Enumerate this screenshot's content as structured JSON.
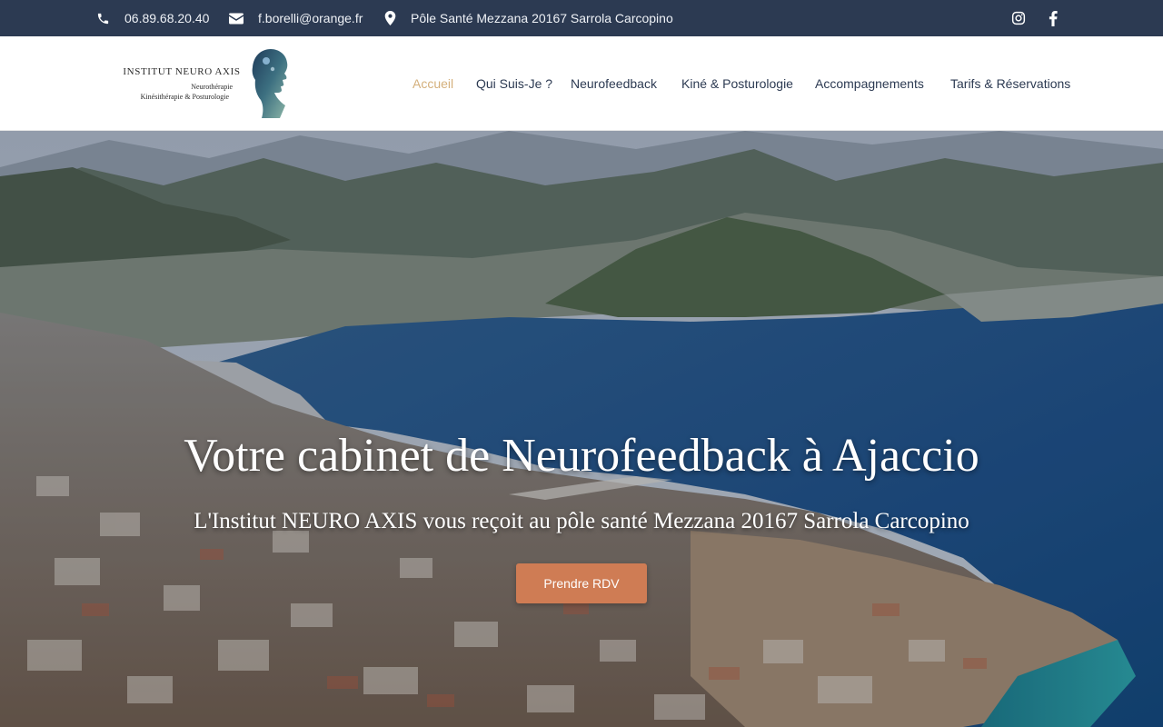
{
  "topbar": {
    "phone": "06.89.68.20.40",
    "email": "f.borelli@orange.fr",
    "address": "Pôle Santé Mezzana 20167 Sarrola Carcopino",
    "icons": [
      "phone-icon",
      "envelope-icon",
      "map-pin-icon",
      "instagram-icon",
      "facebook-icon"
    ],
    "background": "#2c3a52"
  },
  "logo": {
    "title": "INSTITUT NEURO AXIS",
    "subtitle_1": "Neurothérapie",
    "subtitle_2": "Kinésithérapie & Posturologie"
  },
  "nav": {
    "items": [
      {
        "label": "Accueil",
        "active": true
      },
      {
        "label": "Qui Suis-Je ?",
        "active": false
      },
      {
        "label": "Neurofeedback",
        "active": false
      },
      {
        "label": "Kiné & Posturologie",
        "active": false
      },
      {
        "label": "Accompagnements",
        "active": false
      },
      {
        "label": "Tarifs & Réservations",
        "active": false
      }
    ],
    "active_color": "#d4b07c",
    "text_color": "#2c3a52"
  },
  "hero": {
    "title": "Votre cabinet de Neurofeedback à Ajaccio",
    "subtitle": "L'Institut NEURO AXIS vous reçoit au pôle santé Mezzana 20167 Sarrola Carcopino",
    "cta_label": "Prendre RDV",
    "cta_color": "#cf7c54"
  }
}
